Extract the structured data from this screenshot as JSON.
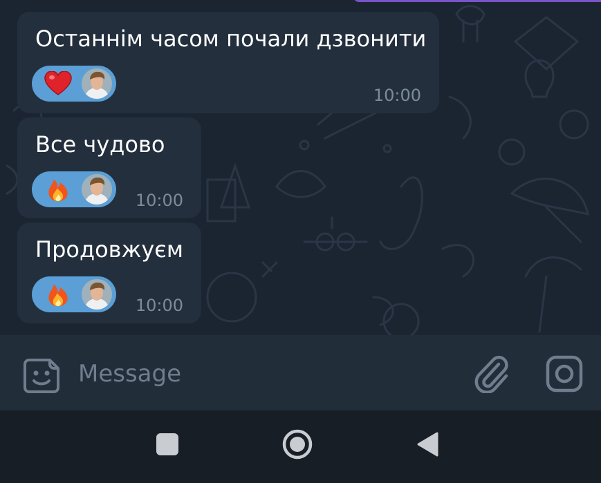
{
  "messages": [
    {
      "text": "Останнім часом почали дзвонити",
      "time": "10:00",
      "reaction": "heart"
    },
    {
      "text": "Все чудово",
      "time": "10:00",
      "reaction": "fire"
    },
    {
      "text": "Продовжуєм",
      "time": "10:00",
      "reaction": "fire"
    }
  ],
  "composer": {
    "placeholder": "Message"
  },
  "colors": {
    "chat_background": "#1b2531",
    "incoming_bubble": "#232f3d",
    "reaction_chip": "#5b9fd6",
    "outgoing_bubble": "#7b54c9",
    "time_text": "#7d8c9c"
  },
  "icons": {
    "composer_left": "sticker-emoji-icon",
    "composer_attach": "paperclip-icon",
    "composer_camera": "instagram-camera-icon",
    "nav": [
      "recents-square-icon",
      "home-circle-icon",
      "back-triangle-icon"
    ]
  }
}
